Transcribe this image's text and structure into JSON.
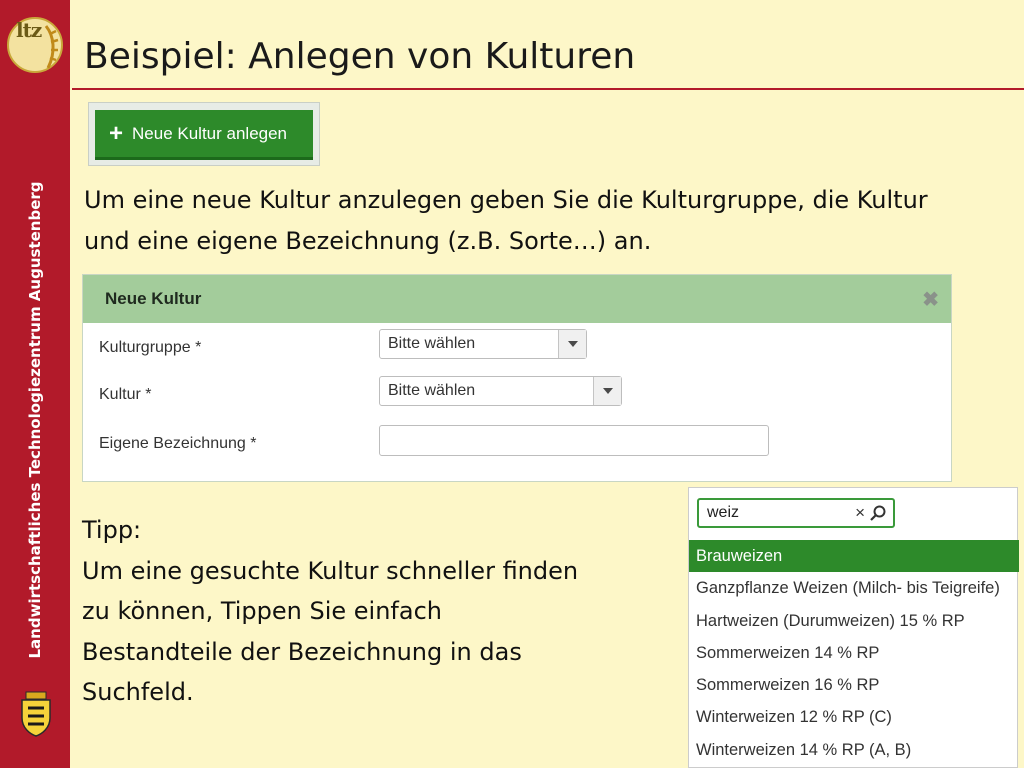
{
  "sidebar": {
    "logo_text": "ltz",
    "vertical_text": "Landwirtschaftliches Technologiezentrum Augustenberg"
  },
  "slide": {
    "title": "Beispiel: Anlegen von Kulturen",
    "button_label": "Neue Kultur anlegen",
    "paragraph_line1": "Um eine neue Kultur anzulegen geben Sie die Kulturgruppe, die Kultur",
    "paragraph_line2": "und eine eigene Bezeichnung (z.B. Sorte…) an.",
    "tip_lines": [
      "Tipp:",
      "Um eine gesuchte Kultur schneller finden",
      "zu können, Tippen Sie einfach",
      "Bestandteile der Bezeichnung in das",
      "Suchfeld."
    ]
  },
  "dialog": {
    "title": "Neue Kultur",
    "close_glyph": "✖",
    "fields": [
      {
        "label": "Kulturgruppe *",
        "value": "Bitte wählen"
      },
      {
        "label": "Kultur *",
        "value": "Bitte wählen"
      },
      {
        "label": "Eigene Bezeichnung *",
        "value": ""
      }
    ]
  },
  "search": {
    "value": "weiz",
    "clear_glyph": "×",
    "results": [
      "Brauweizen",
      "Ganzpflanze Weizen (Milch- bis Teigreife)",
      "Hartweizen (Durumweizen) 15 % RP",
      "Sommerweizen 14 % RP",
      "Sommerweizen 16 % RP",
      "Winterweizen 12 % RP (C)",
      "Winterweizen 14 % RP (A, B)"
    ],
    "active_index": 0
  },
  "colors": {
    "sidebar": "#b21a2a",
    "background": "#fdf7c8",
    "green": "#2d8a2a",
    "dialog_header": "#a3cc9b"
  },
  "icons": {
    "plus": "plus-icon",
    "close": "close-icon",
    "dropdown": "chevron-down-icon",
    "search": "search-icon",
    "clear": "clear-icon"
  }
}
